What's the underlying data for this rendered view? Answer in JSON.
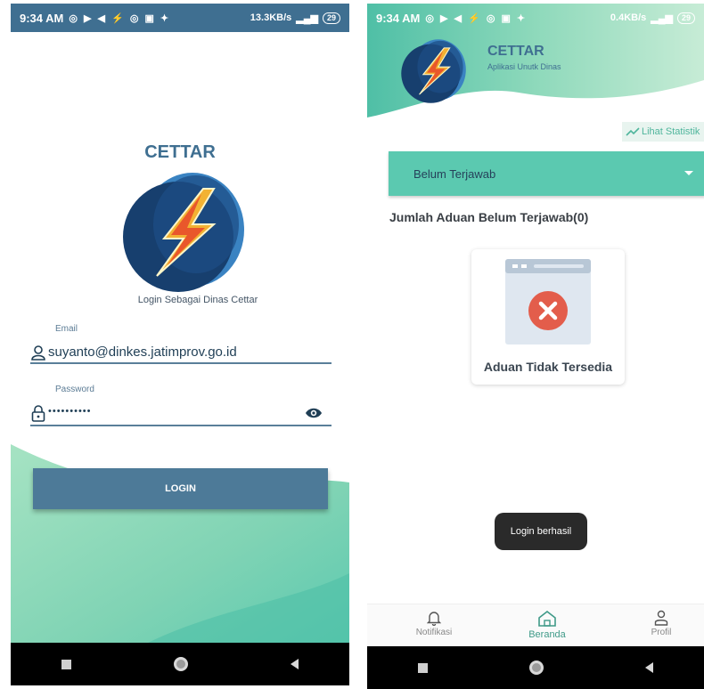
{
  "left_screen": {
    "status_bar": {
      "time": "9:34 AM",
      "left_icons": "◎ ▶ ◀ ⚡ ◎ ▣ ✦",
      "network": "13.3KB/s",
      "battery": "29"
    },
    "title": "CETTAR",
    "subtitle": "Login Sebagai Dinas Cettar",
    "email": {
      "label": "Email",
      "value": "suyanto@dinkes.jatimprov.go.id"
    },
    "password": {
      "label": "Password",
      "value": "••••••••••"
    },
    "login_button": "LOGIN"
  },
  "right_screen": {
    "status_bar": {
      "time": "9:34 AM",
      "left_icons": "◎ ▶ ◀ ⚡ ◎ ▣ ✦",
      "network": "0.4KB/s",
      "battery": "29"
    },
    "app_title": "CETTAR",
    "app_subtitle": "Aplikasi Unutk Dinas",
    "stat_link": "Lihat Statistik",
    "dropdown_value": "Belum Terjawab",
    "count_text": "Jumlah Aduan Belum Terjawab(0)",
    "empty_text": "Aduan Tidak Tersedia",
    "toast": "Login berhasil",
    "bottom_nav": {
      "notifications": "Notifikasi",
      "home": "Beranda",
      "profile": "Profil"
    }
  },
  "colors": {
    "primary": "#3f6f91",
    "accent": "#5bc9b0",
    "error": "#e35d4b"
  }
}
